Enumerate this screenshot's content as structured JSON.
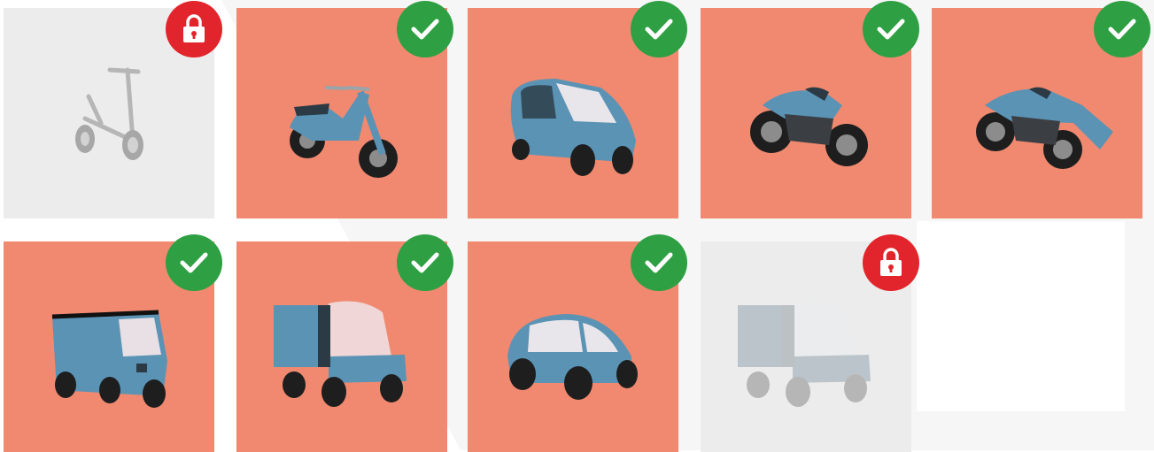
{
  "colors": {
    "selected_tile": "#f0896f",
    "locked_tile": "#ececec",
    "check_badge": "#2ea043",
    "lock_badge": "#e2252c",
    "vehicle_body": "#5b93b5"
  },
  "tiles": [
    {
      "vehicle": "kick-scooter",
      "state": "locked",
      "badge_icon": "lock-icon"
    },
    {
      "vehicle": "moped-scooter",
      "state": "selected",
      "badge_icon": "checkmark-icon"
    },
    {
      "vehicle": "enclosed-trike",
      "state": "selected",
      "badge_icon": "checkmark-icon"
    },
    {
      "vehicle": "sport-motorcycle",
      "state": "selected",
      "badge_icon": "checkmark-icon"
    },
    {
      "vehicle": "faired-motorcycle",
      "state": "selected",
      "badge_icon": "checkmark-icon"
    },
    {
      "vehicle": "cargo-van",
      "state": "selected",
      "badge_icon": "checkmark-icon"
    },
    {
      "vehicle": "cargo-utility-vehicle",
      "state": "selected",
      "badge_icon": "checkmark-icon"
    },
    {
      "vehicle": "micro-car",
      "state": "selected",
      "badge_icon": "checkmark-icon"
    },
    {
      "vehicle": "cargo-utility-vehicle",
      "state": "locked",
      "badge_icon": "lock-icon"
    }
  ]
}
